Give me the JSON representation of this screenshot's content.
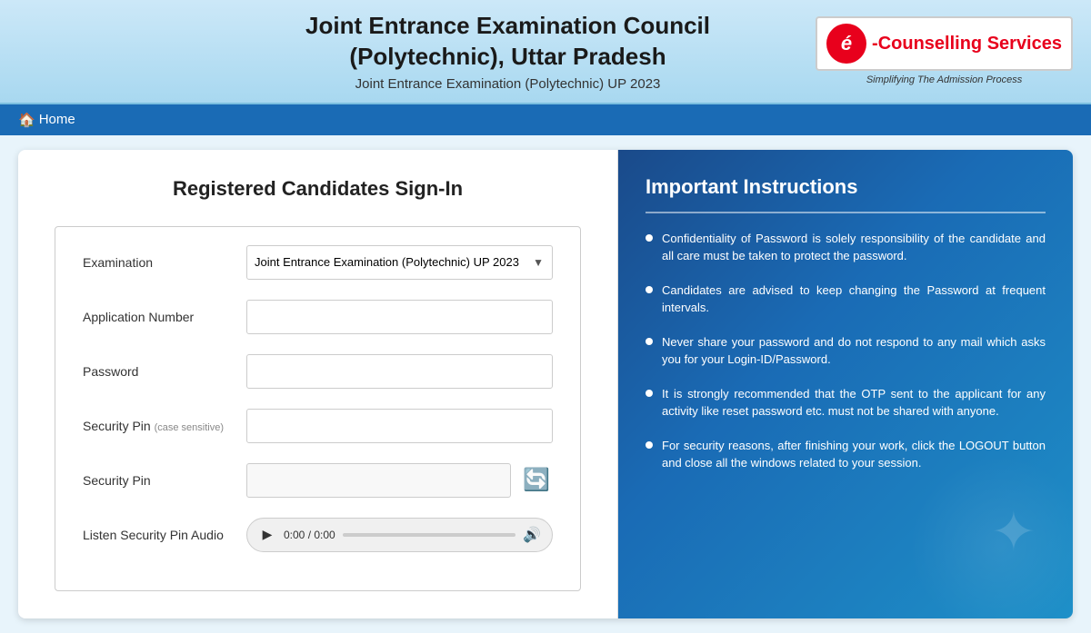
{
  "header": {
    "title_line1": "Joint Entrance Examination Council",
    "title_line2": "(Polytechnic), Uttar Pradesh",
    "subtitle": "Joint Entrance Examination (Polytechnic) UP 2023",
    "logo_icon": "é",
    "logo_text": "-Counselling Services",
    "logo_subtext": "Simplifying The Admission Process"
  },
  "nav": {
    "home_label": "Home",
    "home_icon": "🏠"
  },
  "form": {
    "title": "Registered Candidates Sign-In",
    "examination_label": "Examination",
    "examination_value": "Joint Entrance Examination (Polytechnic) UP 2023",
    "application_number_label": "Application Number",
    "application_number_placeholder": "",
    "password_label": "Password",
    "password_placeholder": "",
    "security_pin_label": "Security Pin",
    "security_pin_case_note": "(case sensitive)",
    "security_pin_placeholder": "",
    "security_pin_image_label": "Security Pin",
    "listen_label": "Listen Security Pin Audio",
    "audio_time": "0:00 / 0:00",
    "refresh_icon": "🔄"
  },
  "instructions": {
    "title": "Important Instructions",
    "items": [
      "Confidentiality of Password is solely responsibility of the candidate and all care must be taken to protect the password.",
      "Candidates are advised to keep changing the Password at frequent intervals.",
      "Never share your password and do not respond to any mail which asks you for your Login-ID/Password.",
      "It is strongly recommended that the OTP sent to the applicant for any activity like reset password etc. must not be shared with anyone.",
      "For security reasons, after finishing your work, click the LOGOUT button and close all the windows related to your session."
    ]
  }
}
